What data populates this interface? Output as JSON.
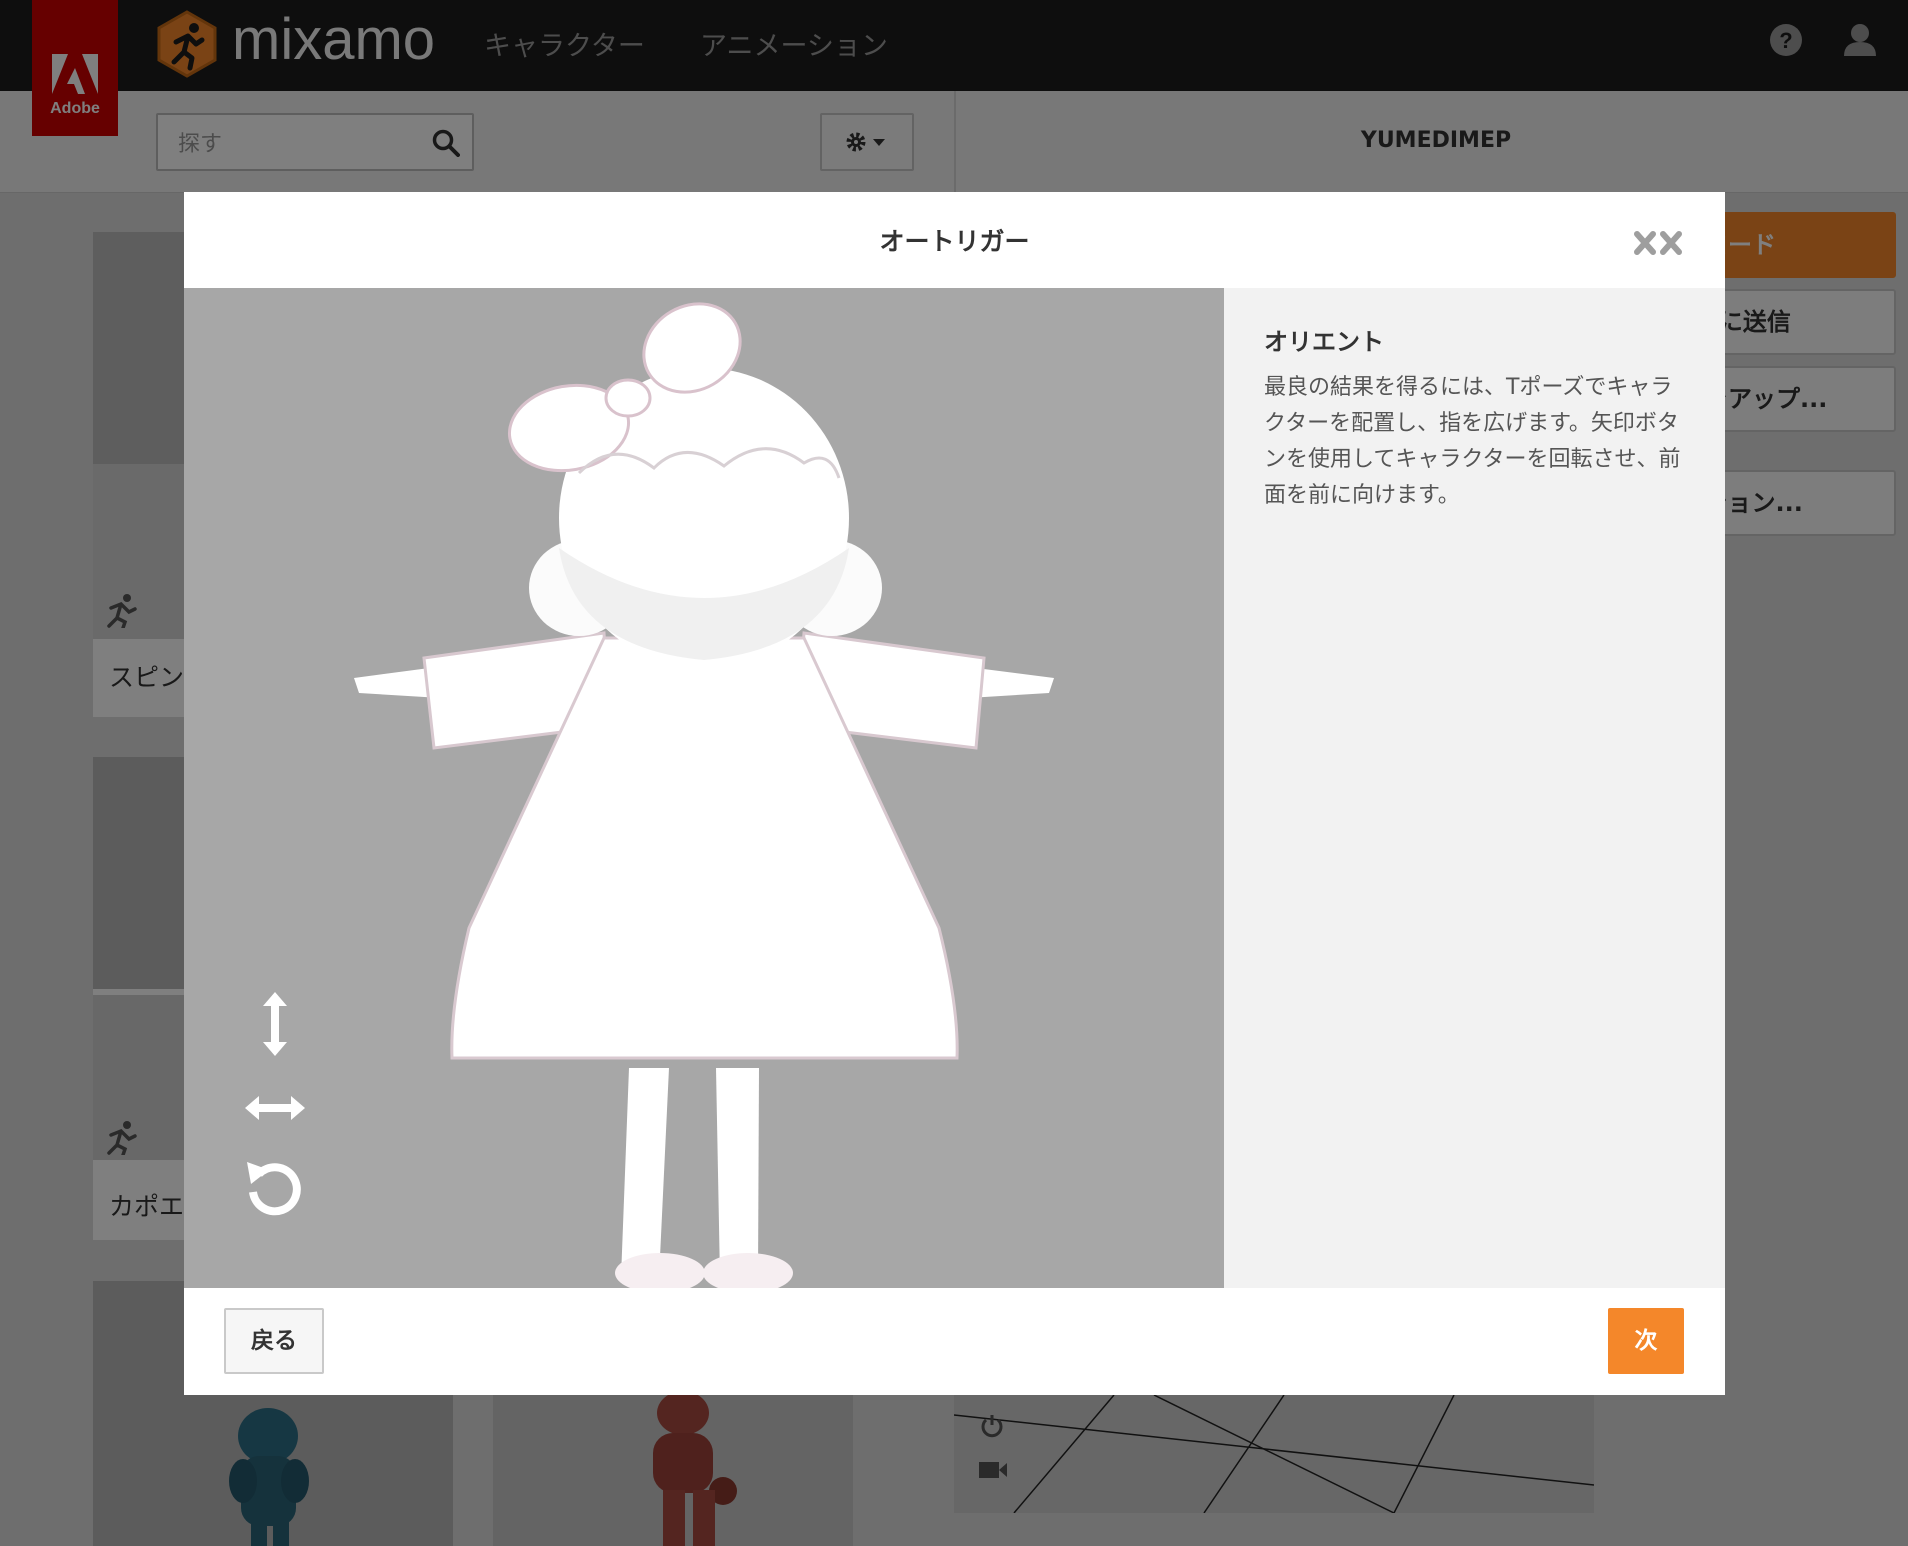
{
  "header": {
    "adobe_label": "Adobe",
    "brand_name": "mixamo",
    "nav": [
      {
        "label": "キャラクター"
      },
      {
        "label": "アニメーション"
      }
    ],
    "icons": [
      "help-icon",
      "user-icon"
    ]
  },
  "toolbar": {
    "search_placeholder": "探す",
    "gear_icon": "gear-icon"
  },
  "character_panel": {
    "name": "YUMEDIMEP",
    "buttons": [
      {
        "label": "ダウンロード",
        "visible_text": "ンロード",
        "style": "primary"
      },
      {
        "label": "ROに送信"
      },
      {
        "label": "ーをアップ..."
      },
      {
        "label": "ーション..."
      }
    ]
  },
  "animation_list": [
    {
      "label": "スピン"
    },
    {
      "label": "カポエ"
    }
  ],
  "modal": {
    "title": "オートリガー",
    "close_icon": "close-icon",
    "panel": {
      "heading": "オリエント",
      "body": "最良の結果を得るには、Tポーズでキャラクターを配置し、指を広げます。矢印ボタンを使用してキャラクターを回転させ、前面を前に向けます。"
    },
    "controls": [
      "vertical-arrow-icon",
      "horizontal-arrow-icon",
      "rotate-icon"
    ],
    "back_label": "戻る",
    "next_label": "次"
  },
  "colors": {
    "accent_orange": "#f4872a",
    "adobe_red": "#cc0000",
    "topbar": "#1d1d1d",
    "viewer_bg": "#a7a7a7"
  }
}
